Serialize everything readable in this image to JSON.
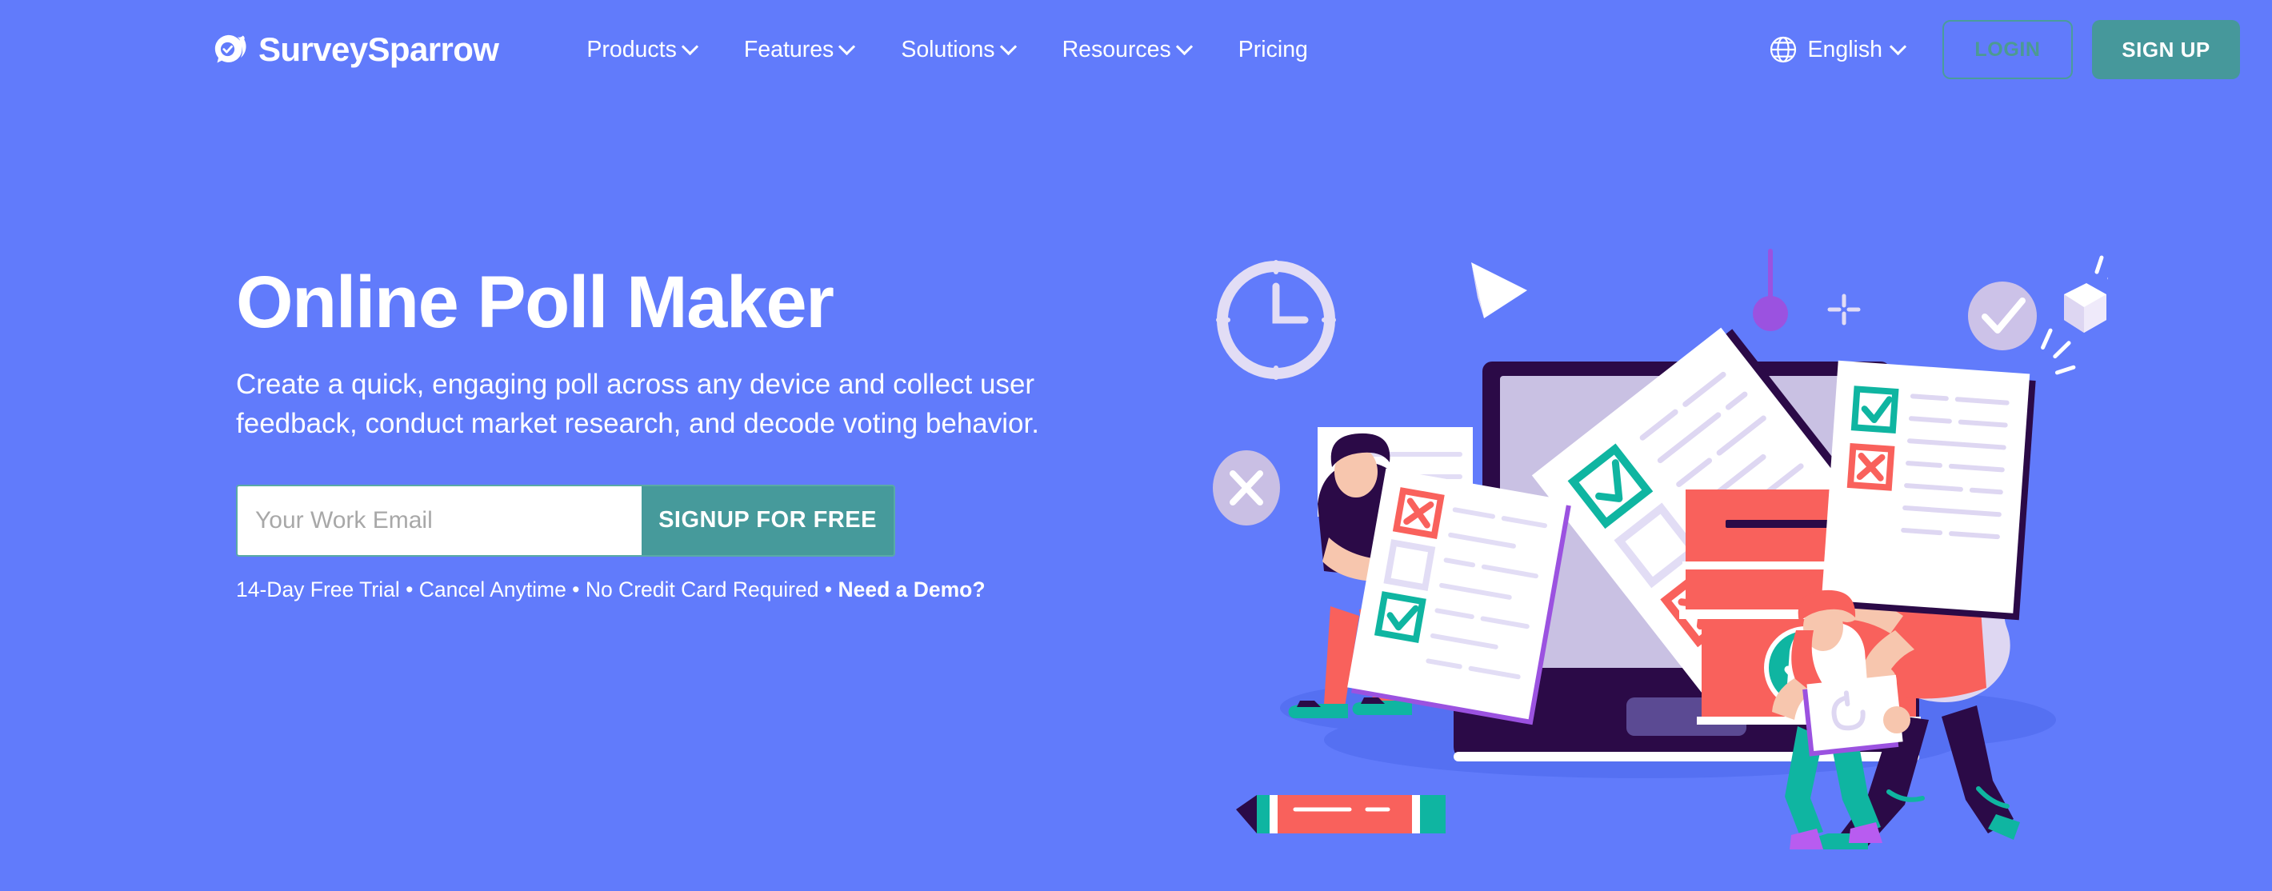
{
  "brand": {
    "name": "SurveySparrow",
    "logo_icon": "sparrow-shield-check-icon"
  },
  "header": {
    "nav": [
      {
        "label": "Products",
        "has_dropdown": true
      },
      {
        "label": "Features",
        "has_dropdown": true
      },
      {
        "label": "Solutions",
        "has_dropdown": true
      },
      {
        "label": "Resources",
        "has_dropdown": true
      },
      {
        "label": "Pricing",
        "has_dropdown": false
      }
    ],
    "language": {
      "icon": "globe-icon",
      "label": "English",
      "has_dropdown": true
    },
    "login_label": "LOGIN",
    "signup_label": "SIGN UP"
  },
  "hero": {
    "title": "Online Poll Maker",
    "subtitle": "Create a quick, engaging poll across any device and collect user feedback, conduct market research, and decode voting behavior.",
    "form": {
      "email_placeholder": "Your Work Email",
      "email_value": "",
      "submit_label": "SIGNUP FOR FREE"
    },
    "trial_text": "14-Day Free Trial • Cancel Anytime • No Credit Card Required • ",
    "demo_link": "Need a Demo?",
    "illustration": "online-poll-ballot-box-illustration"
  },
  "colors": {
    "background": "#617bfb",
    "teal": "#469a9b",
    "login_border": "#4a9c9a",
    "login_text": "#4c9a92",
    "white": "#ffffff",
    "coral": "#f9615c",
    "green_check": "#0fb5a1",
    "dark_navy": "#2b0a47",
    "lavender": "#d4cbe8",
    "purple": "#9b52e0"
  }
}
